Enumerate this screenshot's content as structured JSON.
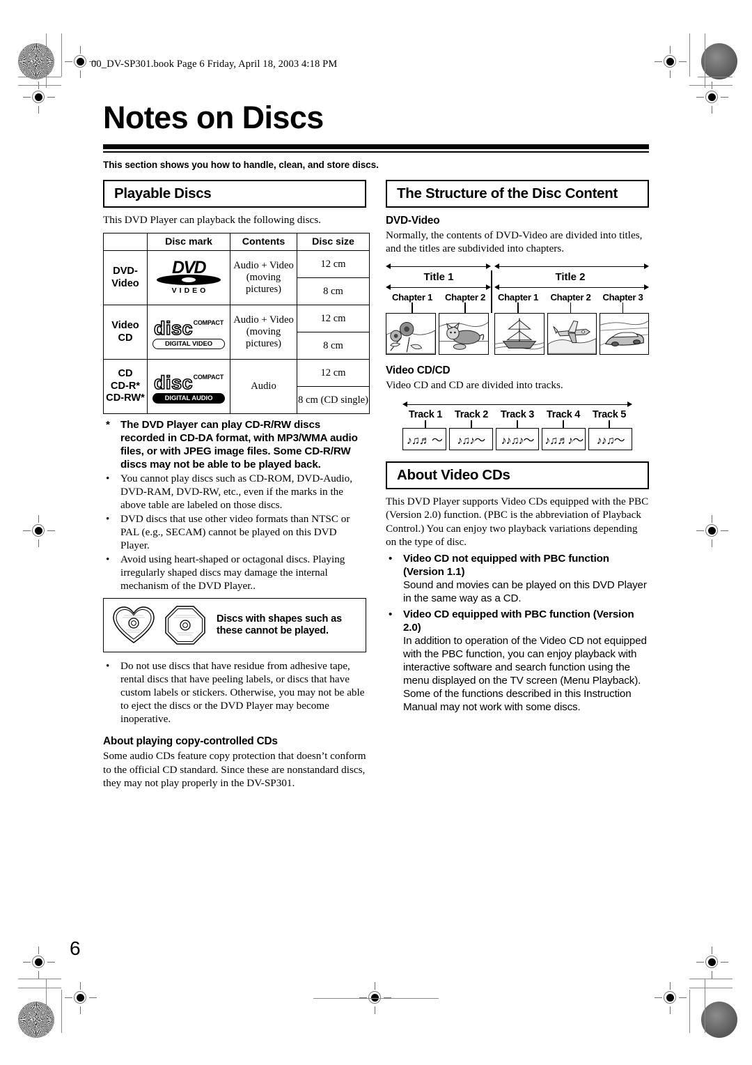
{
  "running_head": "00_DV-SP301.book  Page 6  Friday, April 18, 2003  4:18 PM",
  "page_number": "6",
  "title": "Notes on Discs",
  "lede": "This section shows you how to handle, clean, and store discs.",
  "left": {
    "section_title": "Playable Discs",
    "intro": "This DVD Player can playback the following discs.",
    "table": {
      "headers": [
        "",
        "Disc mark",
        "Contents",
        "Disc size"
      ],
      "rows": [
        {
          "type": "DVD-\nVideo",
          "type_lines": [
            "DVD-",
            "Video"
          ],
          "logo": "dvd-video-logo",
          "logo_text": {
            "main": "DVD",
            "sub": "VIDEO"
          },
          "contents": "Audio + Video (moving pictures)",
          "contents_lines": [
            "Audio + Video",
            "(moving",
            "pictures)"
          ],
          "sizes": [
            "12 cm",
            "8 cm"
          ]
        },
        {
          "type_lines": [
            "Video",
            "CD"
          ],
          "logo": "compact-disc-digital-video-logo",
          "logo_text": {
            "compact": "COMPACT",
            "disc": "disc",
            "tagline": "DIGITAL VIDEO"
          },
          "contents_lines": [
            "Audio + Video",
            "(moving",
            "pictures)"
          ],
          "sizes": [
            "12 cm",
            "8 cm"
          ]
        },
        {
          "type_lines": [
            "CD",
            "CD-R*",
            "CD-RW*"
          ],
          "logo": "compact-disc-digital-audio-logo",
          "logo_text": {
            "compact": "COMPACT",
            "disc": "disc",
            "tagline": "DIGITAL AUDIO"
          },
          "contents_lines": [
            "Audio"
          ],
          "sizes": [
            "12 cm",
            "8 cm (CD single)"
          ]
        }
      ]
    },
    "bullets": [
      {
        "marker": "*",
        "bold": true,
        "text": "The DVD Player can play CD-R/RW discs recorded in CD-DA format, with MP3/WMA audio files, or with JPEG image files. Some CD-R/RW discs may not be able to be played back."
      },
      {
        "marker": "•",
        "bold": false,
        "text": "You cannot play discs such as CD-ROM, DVD-Audio, DVD-RAM, DVD-RW, etc., even if the marks in the above table are labeled on those discs."
      },
      {
        "marker": "•",
        "bold": false,
        "text": "DVD discs that use other video formats than NTSC or PAL (e.g., SECAM) cannot be played on this DVD Player."
      },
      {
        "marker": "•",
        "bold": false,
        "text": "Avoid using heart-shaped or octagonal discs. Playing irregularly shaped discs may damage the internal mechanism of the DVD Player.."
      }
    ],
    "shape_box_text": "Discs with shapes such as these cannot be played.",
    "shape_box_lines": [
      "Discs with shapes such as",
      "these cannot be played."
    ],
    "bullets_after": [
      {
        "marker": "•",
        "text": "Do not use discs that have residue from adhesive tape, rental discs that have peeling labels, or discs that have custom labels or stickers. Otherwise, you may not be able to eject the discs or the DVD Player may become inoperative."
      }
    ],
    "copy_heading": "About playing copy-controlled CDs",
    "copy_body": "Some audio CDs feature copy protection that doesn’t conform to the official CD standard. Since these are nonstandard discs, they may not play properly in the DV-SP301."
  },
  "right": {
    "section_title": "The Structure of the Disc Content",
    "dvd_video_heading": "DVD-Video",
    "dvd_video_body": "Normally, the contents of DVD-Video are divided into titles, and the titles are subdivided into chapters.",
    "titles": [
      {
        "label": "Title 1",
        "chapters": [
          "Chapter 1",
          "Chapter 2"
        ],
        "thumbs": [
          "flowers",
          "cat"
        ]
      },
      {
        "label": "Title 2",
        "chapters": [
          "Chapter 1",
          "Chapter 2",
          "Chapter 3"
        ],
        "thumbs": [
          "sailing-ship",
          "airplane",
          "car"
        ]
      }
    ],
    "videocd_heading": "Video CD/CD",
    "videocd_body": "Video CD and CD are divided into tracks.",
    "tracks": [
      {
        "label": "Track 1",
        "notes": "♪♫♬ ～"
      },
      {
        "label": "Track 2",
        "notes": "♪♫♪～"
      },
      {
        "label": "Track 3",
        "notes": "♪♪♫♪～"
      },
      {
        "label": "Track 4",
        "notes": "♪♫♬♪～"
      },
      {
        "label": "Track 5",
        "notes": "♪♪♫～"
      }
    ],
    "about_title": "About Video CDs",
    "about_body": "This DVD Player supports Video CDs equipped with the PBC (Version 2.0) function. (PBC is the abbreviation of Playback Control.) You can enjoy two playback variations depending on the type of disc.",
    "pbc_items": [
      {
        "heading": "Video CD not equipped with PBC function (Version 1.1)",
        "text": "Sound and movies can be played on this DVD Player in the same way as a CD."
      },
      {
        "heading": "Video CD equipped with PBC function (Version 2.0)",
        "text": "In addition to operation of the Video CD not equipped with the PBC function, you can enjoy playback with interactive software and search function using the menu displayed on the TV screen (Menu Playback). Some of the functions described in this Instruction Manual may not work with some discs."
      }
    ]
  }
}
